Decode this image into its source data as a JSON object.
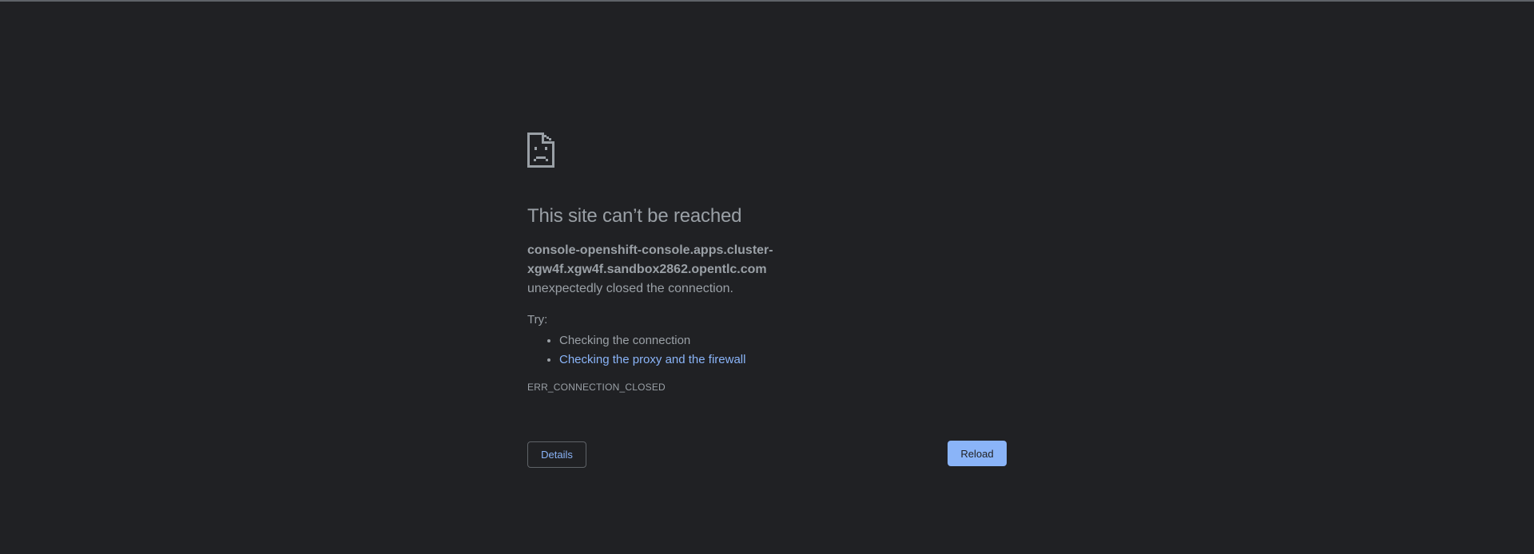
{
  "error_page": {
    "icon": "sad-document-icon",
    "heading": "This site can’t be reached",
    "hostname": "console-openshift-console.apps.cluster-xgw4f.xgw4f.sandbox2862.opentlc.com",
    "message": "unexpectedly closed the connection.",
    "try_label": "Try:",
    "suggestions": [
      "Checking the connection",
      "Checking the proxy and the firewall"
    ],
    "error_code": "ERR_CONNECTION_CLOSED",
    "details_label": "Details",
    "reload_label": "Reload"
  },
  "colors": {
    "background": "#202124",
    "text": "#9aa0a6",
    "link": "#8ab4f8",
    "button_primary": "#8ab4f8"
  }
}
